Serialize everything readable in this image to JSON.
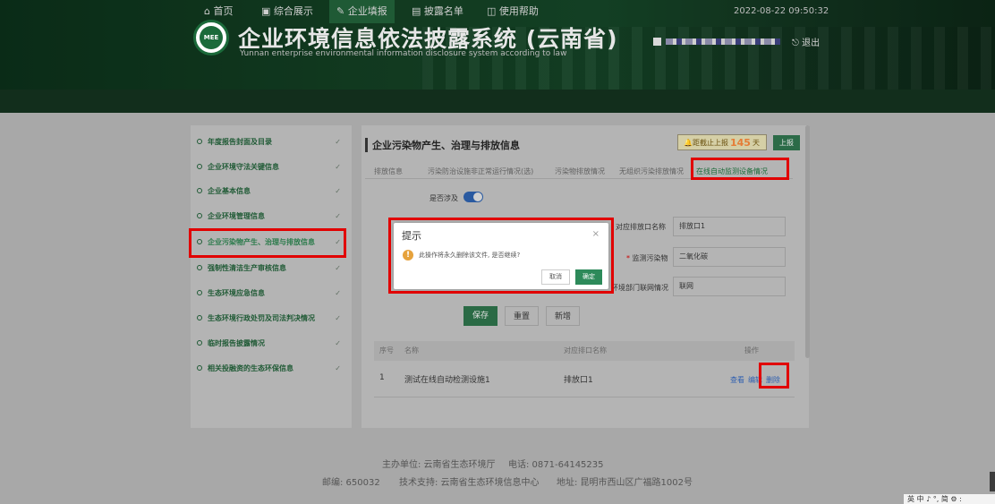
{
  "header": {
    "title": "企业环境信息依法披露系统 (云南省)",
    "subtitle": "Yunnan enterprise environmental information disclosure system according to law",
    "logo_text": "MEE",
    "logout": "退出"
  },
  "nav": {
    "items": [
      "首页",
      "综合展示",
      "企业填报",
      "披露名单",
      "使用帮助"
    ],
    "icons": [
      "home-icon",
      "monitor-icon",
      "edit-icon",
      "list-icon",
      "book-icon"
    ],
    "datetime": "2022-08-22 09:50:32"
  },
  "sidebar": {
    "items": [
      "年度报告封面及目录",
      "企业环境守法关键信息",
      "企业基本信息",
      "企业环境管理信息",
      "企业污染物产生、治理与排放信息",
      "强制性清洁生产审核信息",
      "生态环境应急信息",
      "生态环境行政处罚及司法判决情况",
      "临时报告披露情况",
      "相关投融资的生态环保信息"
    ],
    "arrow": "✓"
  },
  "panel": {
    "title": "企业污染物产生、治理与排放信息",
    "deadline_label": "距截止上报",
    "deadline_days": "145",
    "deadline_unit": "天",
    "report_button": "上报",
    "subtabs": [
      "排放信息",
      "污染防治设施非正常运行情况(选)",
      "污染物排放情况",
      "无组织污染排放情况",
      "在线自动监测设备情况"
    ],
    "switch_label": "是否涉及",
    "fields": [
      {
        "label": "对应排放口名称",
        "value": "排放口1"
      },
      {
        "label": "监测污染物",
        "value": "二氧化碳"
      },
      {
        "label": "环境部门联网情况",
        "value": "联网"
      }
    ],
    "buttons": {
      "save": "保存",
      "reset": "重置",
      "add": "新增"
    },
    "table": {
      "headers": [
        "序号",
        "名称",
        "对应排口名称",
        "操作"
      ],
      "rows": [
        {
          "index": "1",
          "name": "测试在线自动检测设施1",
          "outlet": "排放口1",
          "ops": [
            "查看",
            "编辑",
            "删除"
          ]
        }
      ]
    }
  },
  "modal": {
    "title": "提示",
    "close": "×",
    "message": "此操作将永久删除该文件, 是否继续?",
    "cancel": "取消",
    "ok": "确定"
  },
  "footer": {
    "host": "主办单位: 云南省生态环境厅",
    "phone": "电话: 0871-64145235",
    "zip": "邮编: 650032",
    "support": "技术支持: 云南省生态环境信息中心",
    "address": "地址: 昆明市西山区广福路1002号"
  },
  "ime": "英 中 ♪ °, 简 ⚙ :",
  "colors": {
    "accent": "#1f5a35",
    "highlight": "#e10000",
    "ok_button": "#2d8a5a",
    "warning": "#e6a23c"
  }
}
